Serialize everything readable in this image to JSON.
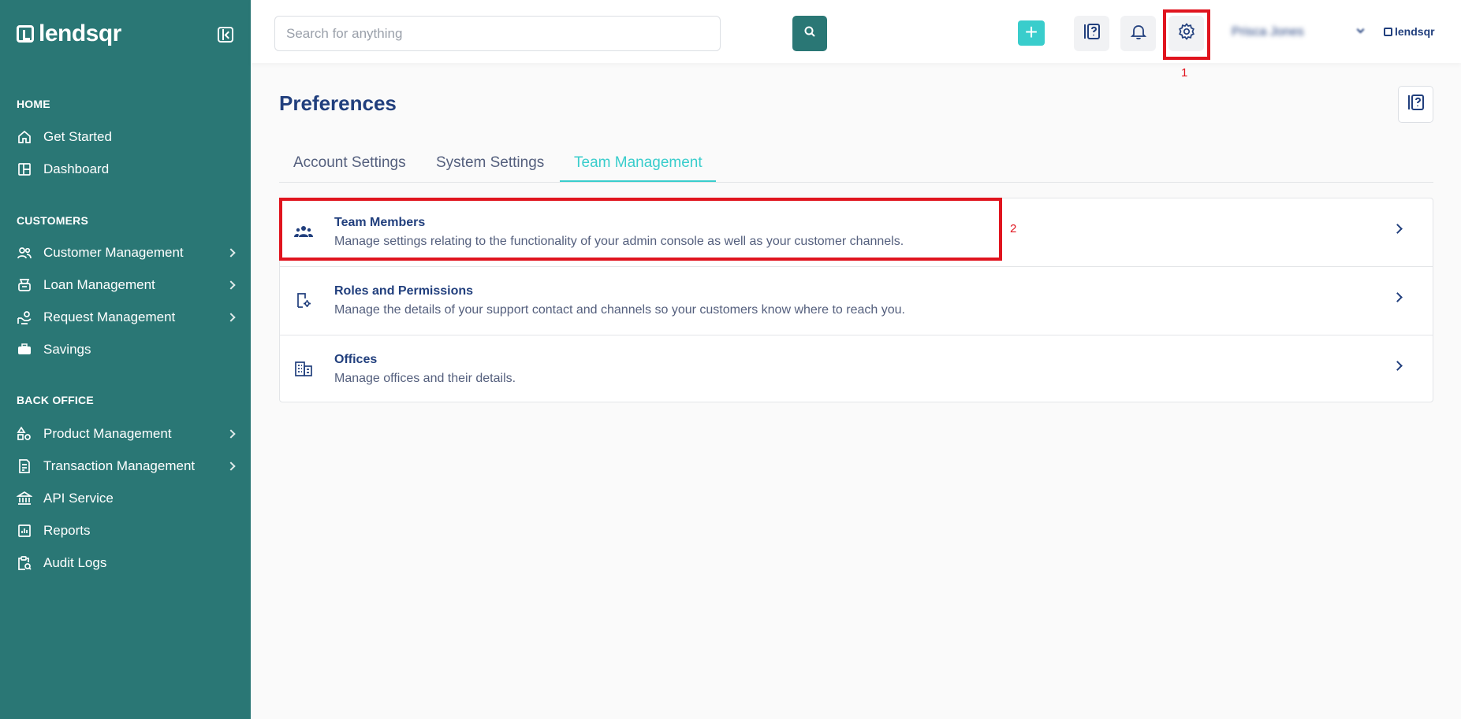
{
  "app": {
    "logo_text": "lendsqr",
    "mini_logo_text": "lendsqr"
  },
  "colors": {
    "sidebar_bg": "#2a7775",
    "accent": "#39cdcc",
    "text_primary": "#213f7d",
    "highlight": "#e0141e"
  },
  "sidebar": {
    "sections": [
      {
        "title": "HOME",
        "items": [
          {
            "label": "Get Started",
            "icon": "home-icon",
            "has_submenu": false
          },
          {
            "label": "Dashboard",
            "icon": "dashboard-icon",
            "has_submenu": false
          }
        ]
      },
      {
        "title": "CUSTOMERS",
        "items": [
          {
            "label": "Customer Management",
            "icon": "users-icon",
            "has_submenu": true
          },
          {
            "label": "Loan Management",
            "icon": "loan-icon",
            "has_submenu": true
          },
          {
            "label": "Request Management",
            "icon": "request-icon",
            "has_submenu": true
          },
          {
            "label": "Savings",
            "icon": "savings-icon",
            "has_submenu": false
          }
        ]
      },
      {
        "title": "BACK OFFICE",
        "items": [
          {
            "label": "Product Management",
            "icon": "product-icon",
            "has_submenu": true
          },
          {
            "label": "Transaction Management",
            "icon": "transaction-icon",
            "has_submenu": true
          },
          {
            "label": "API Service",
            "icon": "bank-icon",
            "has_submenu": false
          },
          {
            "label": "Reports",
            "icon": "reports-icon",
            "has_submenu": false
          },
          {
            "label": "Audit Logs",
            "icon": "audit-icon",
            "has_submenu": false
          }
        ]
      }
    ]
  },
  "topbar": {
    "search_placeholder": "Search for anything",
    "add_label": "+",
    "user_name": "Prisca Jones",
    "annotation_1": "1"
  },
  "main": {
    "title": "Preferences",
    "tabs": [
      {
        "label": "Account Settings",
        "active": false
      },
      {
        "label": "System Settings",
        "active": false
      },
      {
        "label": "Team Management",
        "active": true
      }
    ],
    "rows": [
      {
        "title": "Team Members",
        "description": "Manage settings relating to the functionality of your admin console as well as your customer channels.",
        "icon": "team-icon"
      },
      {
        "title": "Roles and Permissions",
        "description": "Manage the details of your support contact and channels so your customers know where to reach you.",
        "icon": "roles-icon"
      },
      {
        "title": "Offices",
        "description": "Manage offices and their details.",
        "icon": "offices-icon"
      }
    ],
    "annotation_2": "2"
  }
}
